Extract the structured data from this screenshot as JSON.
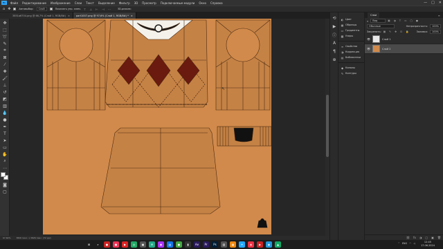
{
  "app": {
    "logo": "Ps"
  },
  "menu": [
    "Файл",
    "Редактирование",
    "Изображение",
    "Слои",
    "Текст",
    "Выделение",
    "Фильтр",
    "3D",
    "Просмотр",
    "Подключаемые модули",
    "Окно",
    "Справка"
  ],
  "window_controls": [
    "—",
    "□",
    "✕"
  ],
  "options": {
    "autoselect": "Автовыбор:",
    "target": "Слой",
    "show_transform": "Показать упр. элем.",
    "mode_3d": "3D-режим:"
  },
  "tabs": [
    {
      "label": "3851a6704.png @ 66,7% (Слой 1, RGB/8#)",
      "close": "×"
    },
    {
      "label": "part1007.png @ 97,6% (Слой 1, RGB/8#) *",
      "close": "×"
    }
  ],
  "status": {
    "zoom": "97,64%",
    "info": "3826 пикс. x 3826 пикс. (72 ppi)"
  },
  "mid_panel": {
    "group1": [
      {
        "icon": "◐",
        "label": "Цвет"
      },
      {
        "icon": "▦",
        "label": "Образцы"
      },
      {
        "icon": "▭",
        "label": "Градиенты"
      },
      {
        "icon": "▩",
        "label": "Узоры"
      }
    ],
    "group2": [
      {
        "icon": "≡",
        "label": "Свойства"
      },
      {
        "icon": "◑",
        "label": "Коррекция"
      },
      {
        "icon": "▤",
        "label": "Библиотеки"
      }
    ],
    "group3": [
      {
        "icon": "◆",
        "label": "Каналы"
      },
      {
        "icon": "✎",
        "label": "Контуры"
      }
    ]
  },
  "layers": {
    "tab": "Слои",
    "filter": "Вид",
    "blend": "Обычные",
    "opacity_label": "Непрозрачность:",
    "opacity": "100%",
    "lock_label": "Закрепить:",
    "fill_label": "Заливка:",
    "fill": "100%",
    "items": [
      {
        "name": "Слой 1",
        "selected": false,
        "thumb": "#e8e8e8"
      },
      {
        "name": "Слой 2",
        "selected": true,
        "thumb": "#d18a4b"
      }
    ],
    "footer": [
      "fx",
      "◑",
      "▢",
      "▣",
      "🗑"
    ]
  },
  "taskbar": {
    "apps": [
      {
        "icon": "⊞",
        "color": "#1c1c1c"
      },
      {
        "icon": "⌕",
        "color": "#1c1c1c"
      },
      {
        "icon": "●",
        "color": "#c22"
      },
      {
        "icon": "●",
        "color": "#e35"
      },
      {
        "icon": "▶",
        "color": "#d22"
      },
      {
        "icon": "◎",
        "color": "#2a6"
      },
      {
        "icon": "▣",
        "color": "#555"
      },
      {
        "icon": "✉",
        "color": "#2a8"
      },
      {
        "icon": "◆",
        "color": "#a3f"
      },
      {
        "icon": "▤",
        "color": "#17e"
      },
      {
        "icon": "●",
        "color": "#4a4"
      },
      {
        "icon": "▮",
        "color": "#333"
      },
      {
        "icon": "Ae",
        "color": "#2a1a5e"
      },
      {
        "icon": "Pr",
        "color": "#2a1a5e"
      },
      {
        "icon": "Ps",
        "color": "#001e36"
      },
      {
        "icon": "▥",
        "color": "#555"
      },
      {
        "icon": "▦",
        "color": "#e81"
      },
      {
        "icon": "✦",
        "color": "#2af"
      },
      {
        "icon": "◈",
        "color": "#e34"
      },
      {
        "icon": "▶",
        "color": "#c22"
      },
      {
        "icon": "◉",
        "color": "#29d"
      },
      {
        "icon": "▲",
        "color": "#1a6"
      }
    ],
    "lang": "ENG",
    "time": "12:45",
    "date": "17.06.2024"
  },
  "colors": {
    "canvas": "#d18a4b",
    "argyle": "#6a1a0e",
    "panel_shadow": "#b9773d"
  }
}
